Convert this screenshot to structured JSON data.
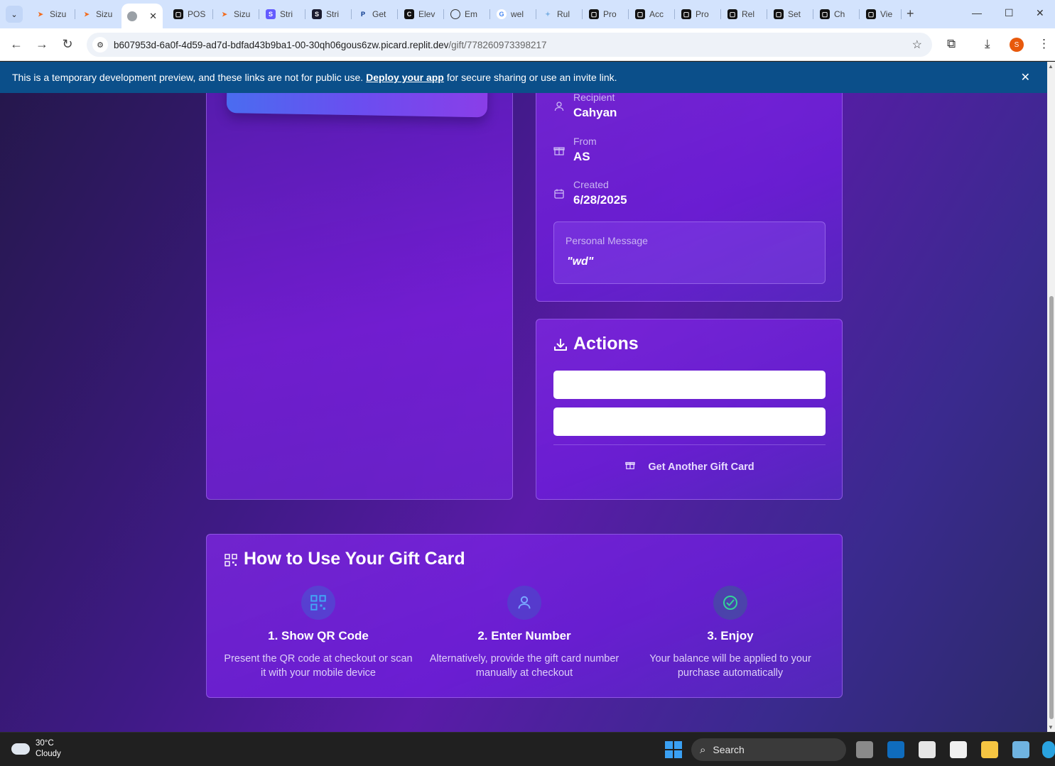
{
  "browser": {
    "tabs": [
      {
        "label": "Sizu",
        "favicon_color": "#f26b1d"
      },
      {
        "label": "Sizu",
        "favicon_color": "#f26b1d"
      },
      {
        "label": "",
        "favicon_color": "#9aa0a6",
        "active": true
      },
      {
        "label": "POS",
        "favicon_color": "#111111"
      },
      {
        "label": "Sizu",
        "favicon_color": "#f26b1d"
      },
      {
        "label": "Stri",
        "favicon_color": "#635bff"
      },
      {
        "label": "Stri",
        "favicon_color": "#1a1a2e"
      },
      {
        "label": "Get",
        "favicon_color": "#003087"
      },
      {
        "label": "Elev",
        "favicon_color": "#111111"
      },
      {
        "label": "Em",
        "favicon_color": "#333333"
      },
      {
        "label": "wel",
        "favicon_color": "#4285f4"
      },
      {
        "label": "Rul",
        "favicon_color": "#7fb2e5"
      },
      {
        "label": "Pro",
        "favicon_color": "#111111"
      },
      {
        "label": "Acc",
        "favicon_color": "#111111"
      },
      {
        "label": "Pro",
        "favicon_color": "#111111"
      },
      {
        "label": "Rel",
        "favicon_color": "#111111"
      },
      {
        "label": "Set",
        "favicon_color": "#111111"
      },
      {
        "label": "Ch",
        "favicon_color": "#111111"
      },
      {
        "label": "Vie",
        "favicon_color": "#111111"
      }
    ],
    "url_host": "b607953d-6a0f-4d59-ad7d-bdfad43b9ba1-00-30qh06gous6zw.picard.replit.dev",
    "url_path": "/gift/778260973398217",
    "profile_initial": "S"
  },
  "banner": {
    "text_before": "This is a temporary development preview, and these links are not for public use.",
    "link": "Deploy your app",
    "text_after": "for secure sharing or use an invite link."
  },
  "details": {
    "recipient_label": "Recipient",
    "recipient_value": "Cahyan",
    "from_label": "From",
    "from_value": "AS",
    "created_label": "Created",
    "created_value": "6/28/2025",
    "message_label": "Personal Message",
    "message_text": "\"wd\""
  },
  "actions": {
    "title": "Actions",
    "button1_label": "",
    "button2_label": "",
    "another_label": "Get Another Gift Card"
  },
  "howto": {
    "title": "How to Use Your Gift Card",
    "steps": [
      {
        "title": "1. Show QR Code",
        "desc": "Present the QR code at checkout or scan it with your mobile device",
        "icon": "qr-code-icon"
      },
      {
        "title": "2. Enter Number",
        "desc": "Alternatively, provide the gift card number manually at checkout",
        "icon": "user-icon"
      },
      {
        "title": "3. Enjoy",
        "desc": "Your balance will be applied to your purchase automatically",
        "icon": "check-circle-icon"
      }
    ]
  },
  "taskbar": {
    "temperature": "30°C",
    "condition": "Cloudy",
    "search_label": "Search"
  }
}
